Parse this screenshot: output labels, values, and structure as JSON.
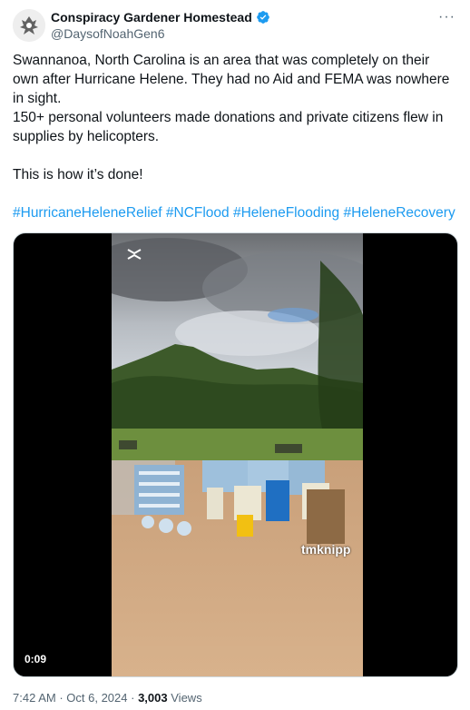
{
  "author": {
    "name": "Conspiracy Gardener Homestead",
    "handle": "@DaysofNoahGen6"
  },
  "tweet": {
    "paragraph1": "Swannanoa, North Carolina is an area that was completely on their own after Hurricane Helene. They had no Aid and FEMA was nowhere in sight.",
    "paragraph2": "150+ personal volunteers made donations and private citizens flew in supplies by helicopters.",
    "paragraph3": "This is how it’s done!",
    "hashtags": [
      "#HurricaneHeleneRelief",
      "#NCFlood",
      "#HeleneFlooding",
      "#HeleneRecovery"
    ]
  },
  "media": {
    "duration": "0:09",
    "watermark": "tmknipp"
  },
  "meta": {
    "time": "7:42 AM",
    "date": "Oct 6, 2024",
    "views_count": "3,003",
    "views_label": "Views"
  },
  "colors": {
    "link": "#1d9bf0",
    "verified": "#1d9bf0",
    "secondary": "#536471"
  }
}
